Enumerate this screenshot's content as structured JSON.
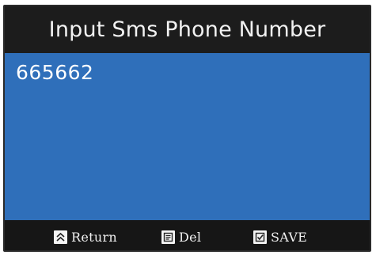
{
  "header": {
    "title": "Input Sms Phone Number"
  },
  "input": {
    "value": "665662"
  },
  "footer": {
    "buttons": [
      {
        "label": "Return",
        "icon": "chevron-up-double-icon"
      },
      {
        "label": "Del",
        "icon": "delete-doc-icon"
      },
      {
        "label": "SAVE",
        "icon": "checkbox-save-icon"
      }
    ]
  },
  "colors": {
    "header_bg": "#1c1c1c",
    "input_bg": "#2f6fba",
    "footer_bg": "#161616",
    "text": "#ffffff"
  }
}
